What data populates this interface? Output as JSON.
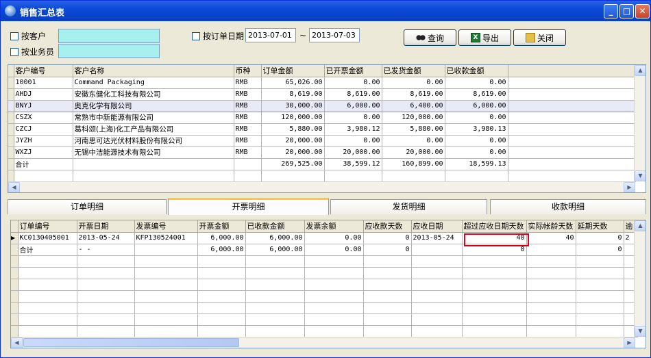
{
  "window": {
    "title": "销售汇总表",
    "min_glyph": "_",
    "max_glyph": "□",
    "close_glyph": "✕"
  },
  "filters": {
    "by_customer_label": "按客户",
    "by_salesman_label": "按业务员",
    "by_order_date_label": "按订单日期",
    "date_from": "2013-07-01",
    "date_sep": "~",
    "date_to": "2013-07-03"
  },
  "toolbar": {
    "query_label": "查询",
    "export_label": "导出",
    "close_label": "关闭",
    "export_icon_text": "X"
  },
  "summary_table": {
    "columns": [
      "客户编号",
      "客户名称",
      "币种",
      "订单金额",
      "已开票金额",
      "已发货金额",
      "已收款金额"
    ],
    "rows": [
      [
        "10001",
        "Command Packaging",
        "RMB",
        "65,026.00",
        "0.00",
        "0.00",
        "0.00"
      ],
      [
        "AHDJ",
        "安徽东健化工科技有限公司",
        "RMB",
        "8,619.00",
        "8,619.00",
        "8,619.00",
        "8,619.00"
      ],
      [
        "BNYJ",
        "奥克化学有限公司",
        "RMB",
        "30,000.00",
        "6,000.00",
        "6,400.00",
        "6,000.00"
      ],
      [
        "CSZX",
        "常熟市中新能源有限公司",
        "RMB",
        "120,000.00",
        "0.00",
        "120,000.00",
        "0.00"
      ],
      [
        "CZCJ",
        "葛科颂(上海)化工产品有限公司",
        "RMB",
        "5,880.00",
        "3,980.12",
        "5,880.00",
        "3,980.13"
      ],
      [
        "JYZH",
        "河南思可达光伏材料股份有限公司",
        "RMB",
        "20,000.00",
        "0.00",
        "0.00",
        "0.00"
      ],
      [
        "WXZJ",
        "无锡中洁能源技术有限公司",
        "RMB",
        "20,000.00",
        "20,000.00",
        "20,000.00",
        "0.00"
      ],
      [
        "合计",
        "",
        "",
        "269,525.00",
        "38,599.12",
        "160,899.00",
        "18,599.13"
      ]
    ],
    "selected_row": 2
  },
  "tabs": [
    {
      "label": "订单明细",
      "active": false
    },
    {
      "label": "开票明细",
      "active": true
    },
    {
      "label": "发货明细",
      "active": false
    },
    {
      "label": "收款明细",
      "active": false
    }
  ],
  "detail_table": {
    "columns": [
      "订单编号",
      "开票日期",
      "发票编号",
      "开票金额",
      "已收款金额",
      "发票余额",
      "应收款天数",
      "应收日期",
      "超过应收日期天数",
      "实际帐龄天数",
      "延期天数",
      "逾"
    ],
    "rows": [
      [
        "KC0130405001",
        "2013-05-24",
        "KFP130524001",
        "6,000.00",
        "6,000.00",
        "0.00",
        "0",
        "2013-05-24",
        "40",
        "40",
        "0",
        "2"
      ],
      [
        "合计",
        "- -",
        "",
        "6,000.00",
        "6,000.00",
        "0.00",
        "0",
        "",
        "0",
        "",
        "0",
        ""
      ]
    ],
    "current_row_marker": "▶"
  },
  "scroll": {
    "up": "▲",
    "down": "▼",
    "left": "◀",
    "right": "▶"
  }
}
